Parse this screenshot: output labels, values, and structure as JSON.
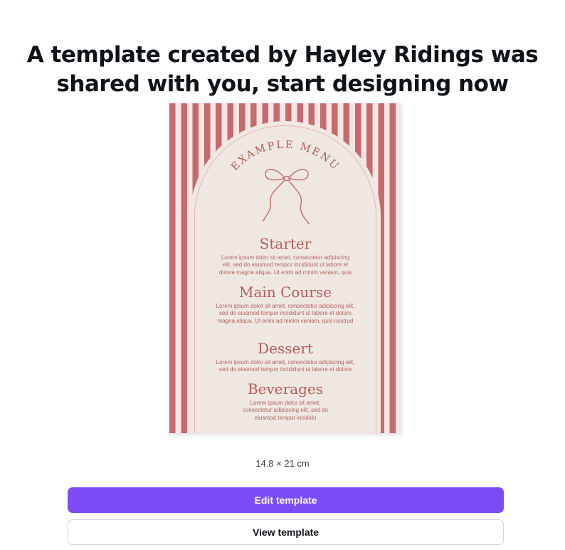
{
  "heading": {
    "line1": "A template created by Hayley Ridings was",
    "line2": "shared with you, start designing now"
  },
  "template": {
    "title": "EXAMPLE MENU",
    "sections": [
      {
        "name": "Starter",
        "lines": [
          "Lorem ipsum dolor sit amet, consectetur adipiscing",
          "elit, sed do eiusmod tempor incididunt ut labore et",
          "dolore magna aliqua. Ut enim ad minim veniam, quis"
        ]
      },
      {
        "name": "Main Course",
        "lines": [
          "Lorem ipsum dolor sit amet, consectetur adipiscing elit,",
          "sed do eiusmod tempor incididunt ut labore et dolore",
          "magna aliqua. Ut enim ad minim veniam, quis nostrud"
        ]
      },
      {
        "name": "Dessert",
        "lines": [
          "Lorem ipsum dolor sit amet, consectetur adipiscing elit,",
          "sed do eiusmod tempor incididunt ut labore et dolore"
        ]
      },
      {
        "name": "Beverages",
        "lines": [
          "Lorem ipsum dolor sit amet,",
          "consectetur adipiscing elit, sed do",
          "eiusmod tempor incididu"
        ]
      }
    ],
    "colors": {
      "stripe": "#c86a6c",
      "stripe_light": "#f3e6e4",
      "panel": "#efe7e2",
      "text": "#b65c58"
    }
  },
  "size_label": "14.8 × 21 cm",
  "buttons": {
    "edit": "Edit template",
    "view": "View template"
  },
  "colors": {
    "primary": "#7d4bf5"
  }
}
